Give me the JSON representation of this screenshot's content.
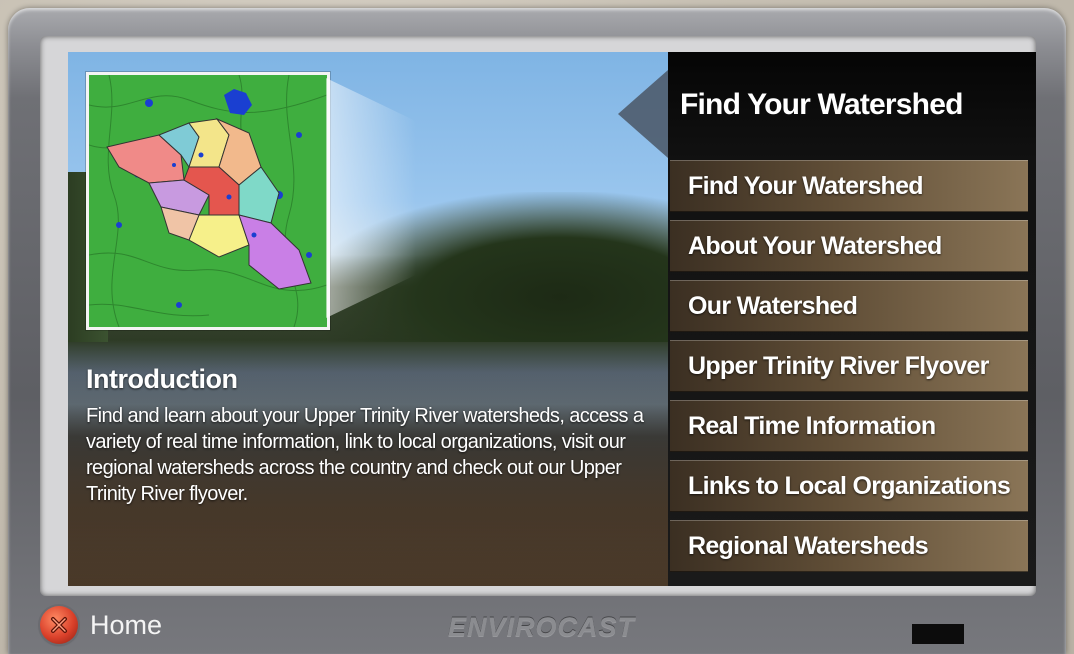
{
  "sidebar": {
    "title": "Find Your Watershed",
    "items": [
      {
        "label": "Find Your Watershed"
      },
      {
        "label": "About Your Watershed"
      },
      {
        "label": "Our Watershed"
      },
      {
        "label": "Upper Trinity River Flyover"
      },
      {
        "label": "Real Time Information"
      },
      {
        "label": "Links to Local Organizations"
      },
      {
        "label": "Regional Watersheds"
      }
    ]
  },
  "intro": {
    "heading": "Introduction",
    "body": "Find and learn about your Upper Trinity River watersheds, access a variety of real time information, link to local organizations, visit our regional watersheds across the country and check out our Upper Trinity River flyover."
  },
  "footer": {
    "home_label": "Home",
    "brand": "ENVIROCAST"
  },
  "colors": {
    "nav_item": "#6b573d",
    "panel": "#111111",
    "home_button": "#d9402a"
  },
  "icons": {
    "home": "close-x-icon"
  }
}
